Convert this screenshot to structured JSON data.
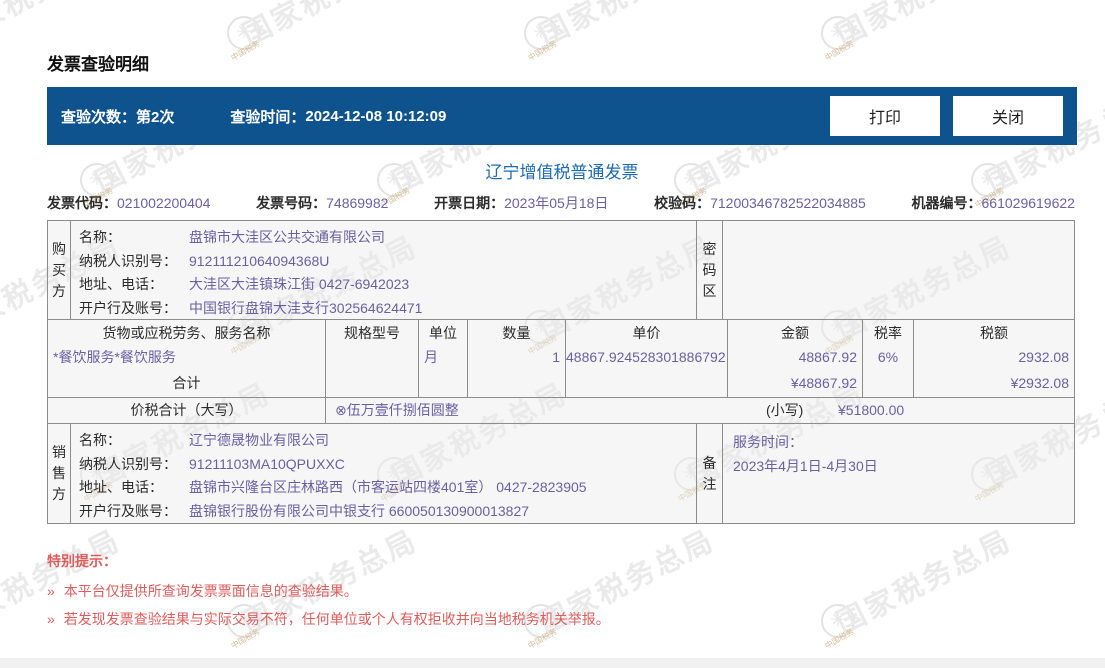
{
  "page_title": "发票查验明细",
  "toolbar": {
    "check_count_label": "查验次数：",
    "check_count_value": "第2次",
    "check_time_label": "查验时间：",
    "check_time_value": "2024-12-08 10:12:09",
    "print_label": "打印",
    "close_label": "关闭"
  },
  "invoice": {
    "title": "辽宁增值税普通发票",
    "code_row": [
      {
        "label": "发票代码：",
        "value": "021002200404"
      },
      {
        "label": "发票号码：",
        "value": "74869982"
      },
      {
        "label": "开票日期：",
        "value": "2023年05月18日"
      },
      {
        "label": "校验码：",
        "value": "71200346782522034885"
      },
      {
        "label": "机器编号：",
        "value": "661029619622"
      }
    ],
    "buyer": {
      "section_label": "购买方",
      "fields": [
        {
          "label": "名称：",
          "value": "盘锦市大洼区公共交通有限公司"
        },
        {
          "label": "纳税人识别号：",
          "value": "91211121064094368U"
        },
        {
          "label": "地址、电话：",
          "value": "大洼区大洼镇珠江街 0427-6942023"
        },
        {
          "label": "开户行及账号：",
          "value": "中国银行盘锦大洼支行302564624471"
        }
      ]
    },
    "password_area": {
      "label": "密码区",
      "content": ""
    },
    "goods": {
      "headers": [
        "货物或应税劳务、服务名称",
        "规格型号",
        "单位",
        "数量",
        "单价",
        "金额",
        "税率",
        "税额"
      ],
      "row": {
        "name": "*餐饮服务*餐饮服务",
        "spec": "",
        "unit": "月",
        "qty": "1",
        "price": "48867.924528301886792",
        "amount": "48867.92",
        "rate": "6%",
        "tax": "2932.08"
      },
      "total": {
        "label": "合计",
        "amount": "¥48867.92",
        "tax": "¥2932.08"
      }
    },
    "tax_total": {
      "label": "价税合计（大写）",
      "in_words": "⊗伍万壹仟捌佰圆整",
      "small_label": "(小写)",
      "small_value": "¥51800.00"
    },
    "seller": {
      "section_label": "销售方",
      "fields": [
        {
          "label": "名称：",
          "value": "辽宁德晟物业有限公司"
        },
        {
          "label": "纳税人识别号：",
          "value": "91211103MA10QPUXXC"
        },
        {
          "label": "地址、电话：",
          "value": "盘锦市兴隆台区庄林路西（市客运站四楼401室） 0427-2823905"
        },
        {
          "label": "开户行及账号：",
          "value": "盘锦银行股份有限公司中银支行 660050130900013827"
        }
      ]
    },
    "remark": {
      "label": "备注",
      "line1": "服务时间：",
      "line2": "2023年4月1日-4月30日"
    }
  },
  "notes": {
    "title": "特别提示：",
    "bullet": "»",
    "items": [
      "本平台仅提供所查询发票票面信息的查验结果。",
      "若发现发票查验结果与实际交易不符，任何单位或个人有权拒收并向当地税务机关举报。"
    ]
  },
  "watermark": {
    "text": "国家税务总局",
    "seal_text": "中国税务"
  },
  "colors": {
    "toolbar_blue": "#0f538e",
    "invoice_title_blue": "#1d6bb0",
    "value_purple": "#6b5fa1",
    "note_red": "#dd5c5c",
    "table_border": "#8c8c8c"
  }
}
